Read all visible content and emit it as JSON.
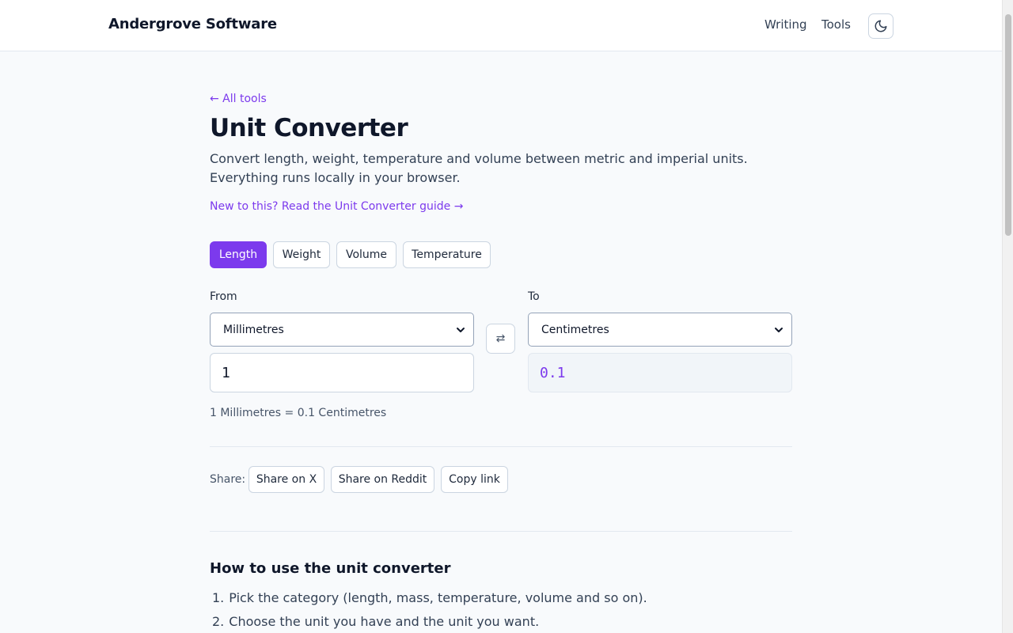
{
  "header": {
    "brand": "Andergrove Software",
    "nav": [
      "Writing",
      "Tools"
    ],
    "theme_icon": "moon-icon"
  },
  "page": {
    "back_link": "← All tools",
    "title": "Unit Converter",
    "description_line1": "Convert length, weight, temperature and volume between metric and imperial units.",
    "description_line2": "Everything runs locally in your browser.",
    "guide_link": "New to this? Read the Unit Converter guide →"
  },
  "categories": {
    "items": [
      "Length",
      "Weight",
      "Volume",
      "Temperature"
    ],
    "active": "Length"
  },
  "converter": {
    "from_label": "From",
    "to_label": "To",
    "from_unit": "Millimetres",
    "to_unit": "Centimetres",
    "swap_symbol": "⇄",
    "input_value": "1",
    "output_value": "0.1",
    "result_text": "1 Millimetres = 0.1 Centimetres"
  },
  "share": {
    "label": "Share:",
    "buttons": [
      "Share on X",
      "Share on Reddit",
      "Copy link"
    ]
  },
  "howto": {
    "title": "How to use the unit converter",
    "steps": [
      {
        "num": "1.",
        "text": "Pick the category (length, mass, temperature, volume and so on)."
      },
      {
        "num": "2.",
        "text": "Choose the unit you have and the unit you want."
      }
    ]
  },
  "colors": {
    "accent": "#7c3aed",
    "text": "#0f172a",
    "muted": "#475569",
    "border": "#cbd5e1",
    "background": "#f8fafc"
  }
}
